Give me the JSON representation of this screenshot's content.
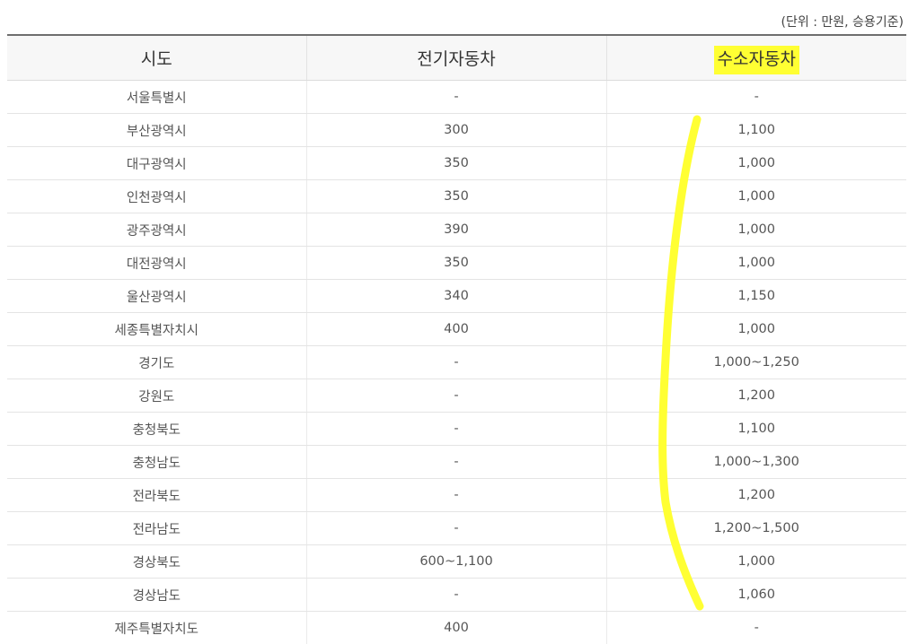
{
  "unit_note": "(단위 : 만원, 승용기준)",
  "table": {
    "headers": [
      "시도",
      "전기자동차",
      "수소자동차"
    ],
    "rows": [
      [
        "서울특별시",
        "-",
        "-"
      ],
      [
        "부산광역시",
        "300",
        "1,100"
      ],
      [
        "대구광역시",
        "350",
        "1,000"
      ],
      [
        "인천광역시",
        "350",
        "1,000"
      ],
      [
        "광주광역시",
        "390",
        "1,000"
      ],
      [
        "대전광역시",
        "350",
        "1,000"
      ],
      [
        "울산광역시",
        "340",
        "1,150"
      ],
      [
        "세종특별자치시",
        "400",
        "1,000"
      ],
      [
        "경기도",
        "-",
        "1,000~1,250"
      ],
      [
        "강원도",
        "-",
        "1,200"
      ],
      [
        "충청북도",
        "-",
        "1,100"
      ],
      [
        "충청남도",
        "-",
        "1,000~1,300"
      ],
      [
        "전라북도",
        "-",
        "1,200"
      ],
      [
        "전라남도",
        "-",
        "1,200~1,500"
      ],
      [
        "경상북도",
        "600~1,100",
        "1,000"
      ],
      [
        "경상남도",
        "-",
        "1,060"
      ],
      [
        "제주특별자치도",
        "400",
        "-"
      ]
    ]
  },
  "highlight_color": "#ffff33"
}
